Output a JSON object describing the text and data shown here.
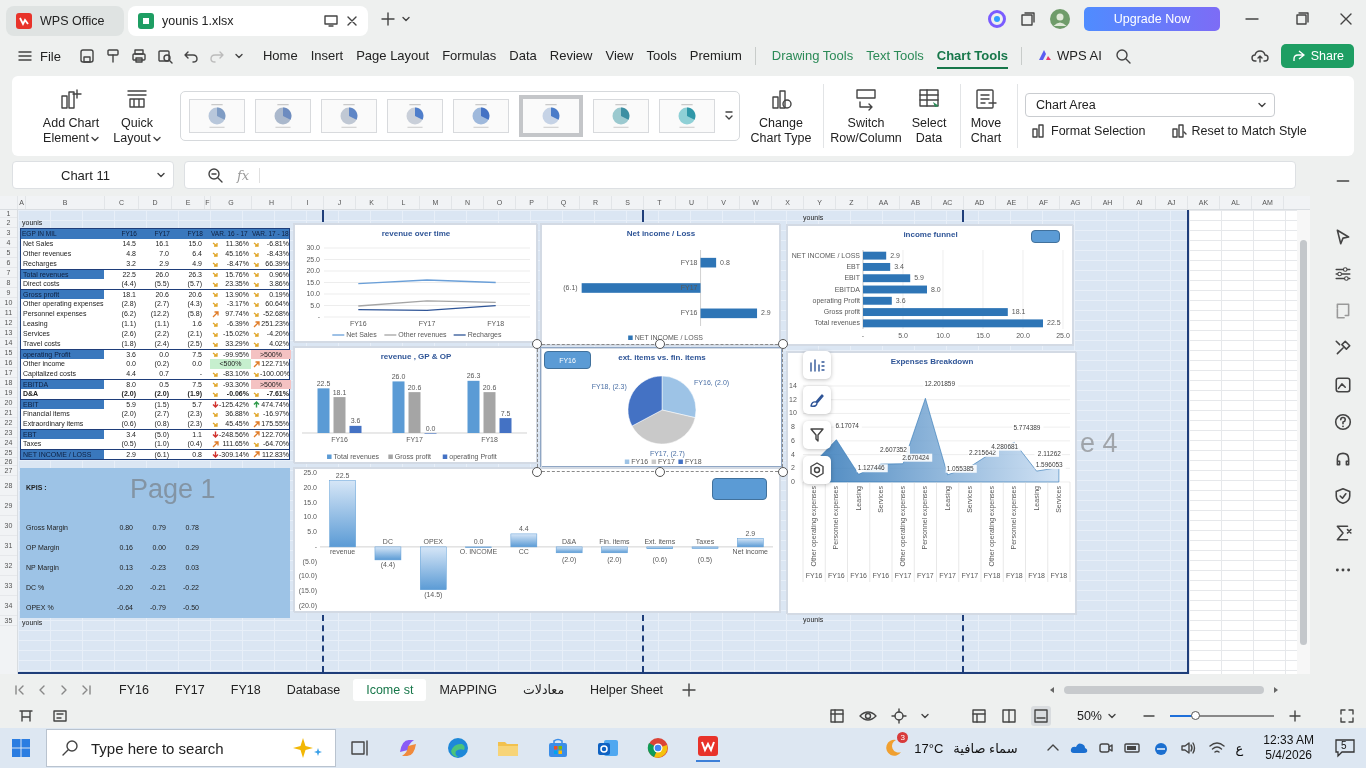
{
  "title_bar": {
    "tabs": [
      {
        "label": "WPS Office",
        "kind": "home",
        "selected": false
      },
      {
        "label": "younis 1.xlsx",
        "kind": "document",
        "selected": true
      }
    ],
    "upgrade_button": "Upgrade Now"
  },
  "menu_bar": {
    "file": "File",
    "items": [
      {
        "label": "Home",
        "kind": "main",
        "selected": false
      },
      {
        "label": "Insert",
        "kind": "main",
        "selected": false
      },
      {
        "label": "Page Layout",
        "kind": "main",
        "selected": false
      },
      {
        "label": "Formulas",
        "kind": "main",
        "selected": false
      },
      {
        "label": "Data",
        "kind": "main",
        "selected": false
      },
      {
        "label": "Review",
        "kind": "main",
        "selected": false
      },
      {
        "label": "View",
        "kind": "main",
        "selected": false
      },
      {
        "label": "Tools",
        "kind": "main",
        "selected": false
      },
      {
        "label": "Premium",
        "kind": "main",
        "selected": false
      },
      {
        "label": "Drawing Tools",
        "kind": "context",
        "selected": false
      },
      {
        "label": "Text Tools",
        "kind": "context",
        "selected": false
      },
      {
        "label": "Chart Tools",
        "kind": "context",
        "selected": true
      },
      {
        "label": "WPS AI",
        "kind": "ai",
        "selected": false
      }
    ],
    "share": "Share"
  },
  "ribbon": {
    "buttons": [
      {
        "label": "Add Chart Element",
        "kind": "dropdown"
      },
      {
        "label": "Quick Layout",
        "kind": "dropdown"
      }
    ],
    "chart_styles": [
      {
        "selected": false
      },
      {
        "selected": false
      },
      {
        "selected": false
      },
      {
        "selected": false
      },
      {
        "selected": false
      },
      {
        "selected": true
      },
      {
        "selected": false
      },
      {
        "selected": false
      }
    ],
    "actions": [
      {
        "label": "Change Chart Type"
      },
      {
        "label": "Switch Row/Column"
      },
      {
        "label": "Select Data"
      },
      {
        "label": "Move Chart"
      }
    ],
    "element_dropdown": "Chart Area",
    "format_selection": "Format Selection",
    "reset_style": "Reset to Match Style"
  },
  "formula_bar": {
    "name_box": "Chart 11",
    "fx": "fx"
  },
  "sheet": {
    "columns": [
      "A",
      "B",
      "C",
      "D",
      "E",
      "F",
      "G",
      "H",
      "I",
      "J",
      "K",
      "L",
      "M",
      "N",
      "O",
      "P",
      "Q",
      "R",
      "S",
      "T",
      "U",
      "V",
      "W",
      "X",
      "Y",
      "Z",
      "AA",
      "AB",
      "AC",
      "AD",
      "AE",
      "AF",
      "AG",
      "AH",
      "AI",
      "AJ",
      "AK",
      "AL",
      "AM"
    ],
    "row_numbers": [
      "1",
      "2",
      "3",
      "4",
      "5",
      "6",
      "7",
      "8",
      "9",
      "10",
      "11",
      "12",
      "13",
      "14",
      "15",
      "16",
      "17",
      "18",
      "19",
      "20",
      "21",
      "22",
      "23",
      "24",
      "25",
      "26",
      "27",
      "28",
      "29",
      "30",
      "31",
      "32",
      "33",
      "34",
      "35"
    ],
    "header_texts": [
      "younis",
      "younis"
    ],
    "footer_texts": [
      "younis",
      "younis"
    ],
    "page_labels": [
      "Page 1",
      "e 4"
    ]
  },
  "table": {
    "columns": [
      "EGP IN MIL",
      "FY16",
      "FY17",
      "FY18",
      "VAR. 16 - 17",
      "VAR. 17 - 18"
    ],
    "rows": [
      {
        "label": "Net Sales",
        "kind": "plain",
        "values": [
          "14.5",
          "16.1",
          "15.0"
        ],
        "var_1": {
          "text": "11.36%",
          "kind": "flat"
        },
        "var_2": {
          "text": "-6.81%",
          "kind": "flat"
        }
      },
      {
        "label": "Other revenues",
        "kind": "plain",
        "values": [
          "4.8",
          "7.0",
          "6.4"
        ],
        "var_1": {
          "text": "45.16%",
          "kind": "flat"
        },
        "var_2": {
          "text": "-8.43%",
          "kind": "flat"
        }
      },
      {
        "label": "Recharges",
        "kind": "plain",
        "values": [
          "3.2",
          "2.9",
          "4.9"
        ],
        "var_1": {
          "text": "-8.47%",
          "kind": "flat"
        },
        "var_2": {
          "text": "66.39%",
          "kind": "flat"
        }
      },
      {
        "label": "Total revenues",
        "kind": "total",
        "values": [
          "22.5",
          "26.0",
          "26.3"
        ],
        "var_1": {
          "text": "15.76%",
          "kind": "flat"
        },
        "var_2": {
          "text": "0.96%",
          "kind": "flat"
        }
      },
      {
        "label": "Direct costs",
        "kind": "plain",
        "values": [
          "(4.4)",
          "(5.5)",
          "(5.7)"
        ],
        "var_1": {
          "text": "23.35%",
          "kind": "flat"
        },
        "var_2": {
          "text": "3.86%",
          "kind": "flat"
        }
      },
      {
        "label": "Gross profit",
        "kind": "total",
        "values": [
          "18.1",
          "20.6",
          "20.6"
        ],
        "var_1": {
          "text": "13.90%",
          "kind": "flat"
        },
        "var_2": {
          "text": "0.19%",
          "kind": "flat"
        }
      },
      {
        "label": "Other operating expenses",
        "kind": "plain",
        "values": [
          "(2.8)",
          "(2.7)",
          "(4.3)"
        ],
        "var_1": {
          "text": "-3.17%",
          "kind": "flat"
        },
        "var_2": {
          "text": "60.64%",
          "kind": "flat"
        }
      },
      {
        "label": "Personnel expenses",
        "kind": "plain",
        "values": [
          "(6.2)",
          "(12.2)",
          "(5.8)"
        ],
        "var_1": {
          "text": "97.74%",
          "kind": "rise"
        },
        "var_2": {
          "text": "-52.68%",
          "kind": "flat"
        }
      },
      {
        "label": "Leasing",
        "kind": "plain",
        "values": [
          "(1.1)",
          "(1.1)",
          "1.6"
        ],
        "var_1": {
          "text": "-6.39%",
          "kind": "flat"
        },
        "var_2": {
          "text": "251.23%",
          "kind": "rise"
        }
      },
      {
        "label": "Services",
        "kind": "plain",
        "values": [
          "(2.6)",
          "(2.2)",
          "(2.1)"
        ],
        "var_1": {
          "text": "-15.02%",
          "kind": "flat"
        },
        "var_2": {
          "text": "-4.20%",
          "kind": "flat"
        }
      },
      {
        "label": "Travel costs",
        "kind": "plain",
        "values": [
          "(1.8)",
          "(2.4)",
          "(2.5)"
        ],
        "var_1": {
          "text": "33.29%",
          "kind": "flat"
        },
        "var_2": {
          "text": "4.02%",
          "kind": "flat"
        }
      },
      {
        "label": "operating Profit",
        "kind": "total",
        "values": [
          "3.6",
          "0.0",
          "7.5"
        ],
        "var_1": {
          "text": "-99.95%",
          "kind": "flat"
        },
        "var_2": {
          "text": ">500%",
          "color": "#f4c2c2"
        }
      },
      {
        "label": "Other income",
        "kind": "plain",
        "values": [
          "0.0",
          "(0.2)",
          "0.0"
        ],
        "var_1": {
          "text": "<500%",
          "color": "#c6efce"
        },
        "var_2": {
          "text": "122.71%",
          "kind": "rise"
        }
      },
      {
        "label": "Capitalized costs",
        "kind": "plain",
        "values": [
          "4.4",
          "0.7",
          "-"
        ],
        "var_1": {
          "text": "-83.10%",
          "kind": "flat"
        },
        "var_2": {
          "text": "-100.00%",
          "kind": "flat"
        }
      },
      {
        "label": "EBITDA",
        "kind": "total",
        "values": [
          "8.0",
          "0.5",
          "7.5"
        ],
        "var_1": {
          "text": "-93.30%",
          "kind": "flat"
        },
        "var_2": {
          "text": ">500%",
          "color": "#f4c2c2"
        }
      },
      {
        "label": "D&A",
        "kind": "bold",
        "values": [
          "(2.0)",
          "(2.0)",
          "(1.9)"
        ],
        "var_1": {
          "text": "-0.06%",
          "kind": "flat"
        },
        "var_2": {
          "text": "-7.61%",
          "kind": "flat"
        }
      },
      {
        "label": "EBIT",
        "kind": "total",
        "values": [
          "5.9",
          "(1.5)",
          "5.7"
        ],
        "var_1": {
          "text": "-125.42%",
          "kind": "down"
        },
        "var_2": {
          "text": "474.74%",
          "kind": "up"
        }
      },
      {
        "label": "Financial items",
        "kind": "plain",
        "values": [
          "(2.0)",
          "(2.7)",
          "(2.3)"
        ],
        "var_1": {
          "text": "36.88%",
          "kind": "flat"
        },
        "var_2": {
          "text": "-16.97%",
          "kind": "flat"
        }
      },
      {
        "label": "Extraordinary items",
        "kind": "plain",
        "values": [
          "(0.6)",
          "(0.8)",
          "(2.3)"
        ],
        "var_1": {
          "text": "45.45%",
          "kind": "flat"
        },
        "var_2": {
          "text": "175.55%",
          "kind": "rise"
        }
      },
      {
        "label": "EBT",
        "kind": "total",
        "values": [
          "3.4",
          "(5.0)",
          "1.1"
        ],
        "var_1": {
          "text": "-248.56%",
          "kind": "down"
        },
        "var_2": {
          "text": "122.70%",
          "kind": "rise"
        }
      },
      {
        "label": "Taxes",
        "kind": "plain",
        "values": [
          "(0.5)",
          "(1.0)",
          "(0.4)"
        ],
        "var_1": {
          "text": "111.65%",
          "kind": "rise"
        },
        "var_2": {
          "text": "-64.70%",
          "kind": "flat"
        }
      },
      {
        "label": "NET INCOME / LOSS",
        "kind": "total",
        "values": [
          "2.9",
          "(6.1)",
          "0.8"
        ],
        "var_1": {
          "text": "-309.14%",
          "kind": "down"
        },
        "var_2": {
          "text": "112.83%",
          "kind": "rise"
        }
      }
    ]
  },
  "kpis": {
    "title": "KPIS :",
    "rows": [
      {
        "label": "Gross Margin",
        "values": [
          "0.80",
          "0.79",
          "0.78"
        ]
      },
      {
        "label": "OP Margin",
        "values": [
          "0.16",
          "0.00",
          "0.29"
        ]
      },
      {
        "label": "NP Margin",
        "values": [
          "0.13",
          "-0.23",
          "0.03"
        ]
      },
      {
        "label": "DC %",
        "values": [
          "-0.20",
          "-0.21",
          "-0.22"
        ]
      },
      {
        "label": "OPEX %",
        "values": [
          "-0.64",
          "-0.79",
          "-0.50"
        ]
      }
    ]
  },
  "charts": [
    {
      "selected": false,
      "chart_data": {
        "type": "line",
        "title": "revenue over time",
        "categories": [
          "FY16",
          "FY17",
          "FY18"
        ],
        "series": [
          {
            "name": "Net Sales",
            "color": "#6a9fd8",
            "values": [
              14.5,
              16.1,
              15.0
            ]
          },
          {
            "name": "Other revenues",
            "color": "#a5a5a5",
            "values": [
              4.8,
              7.0,
              6.4
            ]
          },
          {
            "name": "Recharges",
            "color": "#2f5597",
            "values": [
              3.2,
              2.9,
              4.9
            ]
          }
        ],
        "yticks": [
          {
            "value": 0,
            "label": "-"
          },
          {
            "value": 5,
            "label": "5.0"
          },
          {
            "value": 10,
            "label": "10.0"
          },
          {
            "value": 15,
            "label": "15.0"
          },
          {
            "value": 20,
            "label": "20.0"
          },
          {
            "value": 25,
            "label": "25.0"
          },
          {
            "value": 30,
            "label": "30.0"
          }
        ],
        "ylim": [
          0,
          30
        ],
        "grid": true,
        "legend": true
      }
    },
    {
      "selected": false,
      "chart_data": {
        "type": "bar",
        "orientation": "horizontal",
        "title": "Net income / Loss",
        "categories": [
          "FY18",
          "FY17",
          "FY16"
        ],
        "series": [
          {
            "name": "NET INCOME / LOSS",
            "color": "#2e75b6",
            "values": [
              0.8,
              -6.1,
              2.9
            ],
            "value_labels": [
              "0.8",
              "(6.1)",
              "2.9"
            ]
          }
        ],
        "legend": true
      }
    },
    {
      "selected": false,
      "slicer": {
        "kind": "blank"
      },
      "chart_data": {
        "type": "bar",
        "orientation": "horizontal",
        "title": "income funnel",
        "categories": [
          "NET INCOME / LOSS",
          "EBT",
          "EBIT",
          "EBITDA",
          "operating Profit",
          "Gross profit",
          "Total revenues"
        ],
        "series": [
          {
            "color": "#2e75b6",
            "values": [
              2.9,
              3.4,
              5.9,
              8.0,
              3.6,
              18.1,
              22.5
            ]
          }
        ],
        "xticks": [
          {
            "value": 0,
            "label": "-"
          },
          {
            "value": 5,
            "label": "5.0"
          },
          {
            "value": 10,
            "label": "10.0"
          },
          {
            "value": 15,
            "label": "15.0"
          },
          {
            "value": 20,
            "label": "20.0"
          },
          {
            "value": 25,
            "label": "25.0"
          }
        ],
        "value_labels": [
          "2.9",
          "3.4",
          "5.9",
          "8.0",
          "3.6",
          "18.1",
          "22.5"
        ],
        "xlim": [
          0,
          25
        ],
        "grid": true
      }
    },
    {
      "selected": false,
      "chart_data": {
        "type": "bar",
        "title": "revenue , GP & OP",
        "categories": [
          "FY16",
          "FY17",
          "FY18"
        ],
        "series": [
          {
            "name": "Total revenues",
            "color": "#5b9bd5",
            "values": [
              22.5,
              26.0,
              26.3
            ],
            "value_labels": [
              "22.5",
              "26.0",
              "26.3"
            ]
          },
          {
            "name": "Gross profit",
            "color": "#a5a5a5",
            "values": [
              18.1,
              20.6,
              20.6
            ],
            "value_labels": [
              "18.1",
              "20.6",
              "20.6"
            ]
          },
          {
            "name": "operating Profit",
            "color": "#4472c4",
            "values": [
              3.6,
              0.0,
              7.5
            ],
            "value_labels": [
              "3.6",
              "0.0",
              "7.5"
            ]
          }
        ],
        "legend": true
      }
    },
    {
      "selected": true,
      "slicer": {
        "kind": "labeled",
        "label": "FY16"
      },
      "chart_data": {
        "type": "pie",
        "title": "ext. items  vs.  fin. items",
        "categories": [
          "FY16",
          "FY17",
          "FY18"
        ],
        "series": [
          {
            "values": [
              28.6,
              38.6,
              32.8
            ]
          }
        ],
        "colors": [
          "#9dc3e6",
          "#c9c9c9",
          "#4472c4"
        ],
        "value_labels": [
          "FY16, (2.0)",
          "FY17, (2.7)",
          "FY18, (2.3)"
        ],
        "legend": true
      }
    },
    {
      "selected": false,
      "slicer": {
        "kind": "blank"
      },
      "chart_data": {
        "type": "bar",
        "categories": [
          "revenue",
          "DC",
          "OPEX",
          "O. INCOME",
          "CC",
          "D&A",
          "Fin. items",
          "Ext. items",
          "Taxes",
          "Net income"
        ],
        "series": [
          {
            "color": "#5b9bd5",
            "values": [
              22.5,
              -4.4,
              -14.5,
              0.0,
              4.4,
              -2.0,
              -2.0,
              -0.6,
              -0.5,
              2.9
            ]
          }
        ],
        "yticks": [
          {
            "value": -20,
            "label": "(20.0)"
          },
          {
            "value": -15,
            "label": "(15.0)"
          },
          {
            "value": -10,
            "label": "(10.0)"
          },
          {
            "value": -5,
            "label": "(5.0)"
          },
          {
            "value": 0,
            "label": "-"
          },
          {
            "value": 5,
            "label": "5.0"
          },
          {
            "value": 10,
            "label": "10.0"
          },
          {
            "value": 15,
            "label": "15.0"
          },
          {
            "value": 20,
            "label": "20.0"
          },
          {
            "value": 25,
            "label": "25.0"
          }
        ],
        "ylim": [
          -20,
          25
        ],
        "value_labels": [
          "22.5",
          "(4.4)",
          "(14.5)",
          "0.0",
          "4.4",
          "(2.0)",
          "(2.0)",
          "(0.6)",
          "(0.5)",
          "2.9"
        ]
      }
    },
    {
      "selected": false,
      "group_labels": [
        "FY16",
        "FY16",
        "FY16",
        "FY16",
        "FY17",
        "FY17",
        "FY17",
        "FY17",
        "FY18",
        "FY18",
        "FY18",
        "FY18"
      ],
      "chart_data": {
        "type": "area",
        "title": "Expenses Breakdown",
        "categories": [
          "Other operating expenses",
          "Personnel expenses",
          "Leasing",
          "Services",
          "Other operating expenses",
          "Personnel expenses",
          "Leasing",
          "Services",
          "Other operating expenses",
          "Personnel expenses",
          "Leasing",
          "Services"
        ],
        "series": [
          {
            "color": "#2e75b6",
            "values": [
              2.8,
              6.17074,
              1.127446,
              2.607352,
              2.670424,
              12.201859,
              1.055385,
              2.215642,
              4.280681,
              5.774389,
              1.596053,
              2.11262
            ]
          }
        ],
        "yticks": [
          {
            "value": 0,
            "label": "0"
          },
          {
            "value": 2,
            "label": "2"
          },
          {
            "value": 4,
            "label": "4"
          },
          {
            "value": 6,
            "label": "6"
          },
          {
            "value": 8,
            "label": "8"
          },
          {
            "value": 10,
            "label": "10"
          },
          {
            "value": 12,
            "label": "12"
          },
          {
            "value": 14,
            "label": "14"
          }
        ],
        "value_labels": [
          null,
          "6.17074",
          "1.127446",
          "2.607352",
          "2.670424",
          "12.201859",
          "1.055385",
          "2.215642",
          "4.280681",
          "5.774389",
          "1.596053",
          "2.11262"
        ],
        "ylim": [
          0,
          14
        ],
        "grid": true
      }
    }
  ],
  "sheet_tabs": [
    {
      "label": "FY16",
      "selected": false
    },
    {
      "label": "FY17",
      "selected": false
    },
    {
      "label": "FY18",
      "selected": false
    },
    {
      "label": "Database",
      "selected": false
    },
    {
      "label": "Icome st",
      "selected": true
    },
    {
      "label": "MAPPING",
      "selected": false
    },
    {
      "label": "معادلات",
      "selected": false
    },
    {
      "label": "Helper Sheet",
      "selected": false
    }
  ],
  "status_bar": {
    "zoom": "50%",
    "zoom_slider": {
      "level": 0.24
    }
  },
  "taskbar": {
    "search_placeholder": "Type here to search",
    "weather_badge": "3",
    "temperature": "17°C",
    "weather": "سماء صافية",
    "language": "ع",
    "time": "12:33 AM",
    "date": "5/4/2026",
    "notifications": "5"
  }
}
